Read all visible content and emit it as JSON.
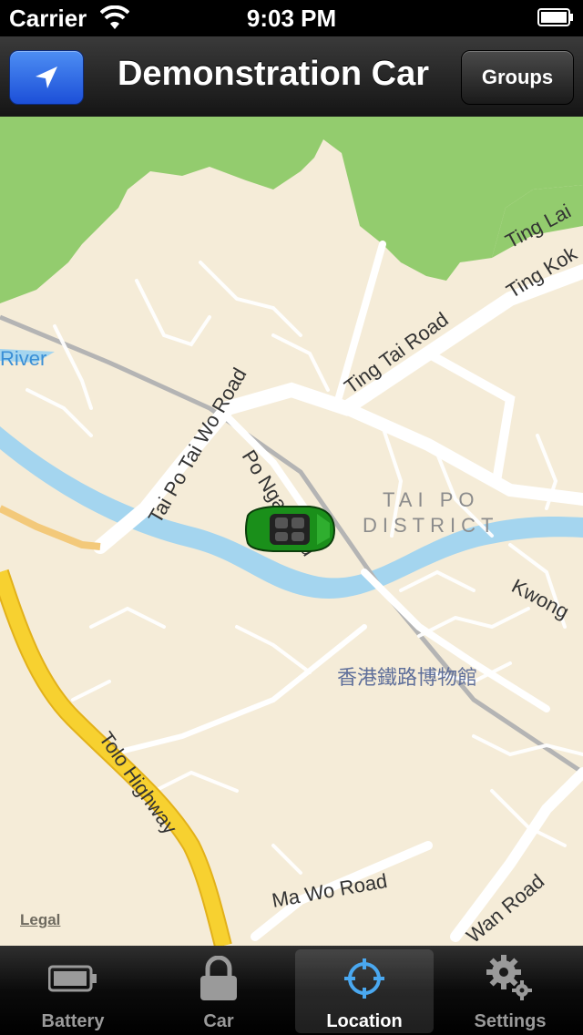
{
  "status_bar": {
    "carrier": "Carrier",
    "time": "9:03 PM"
  },
  "nav": {
    "title": "Demonstration Car",
    "groups_label": "Groups",
    "locate_icon": "location-arrow-icon"
  },
  "map": {
    "labels": {
      "river": "River",
      "ting_lai": "Ting Lai",
      "ting_kok": "Ting Kok",
      "ting_tai_road": "Ting Tai Road",
      "tai_po_tai_wo_road": "Tai Po Tai Wo Road",
      "po_nga_road": "Po Nga Road",
      "tai_po": "TAI PO",
      "district": "DISTRICT",
      "kwong": "Kwong",
      "museum": "香港鐵路博物館",
      "tolo_highway": "Tolo Highway",
      "wan_road": "Wan Road",
      "ma_wo_road": "Ma Wo Road"
    },
    "legal": "Legal",
    "colors": {
      "land": "#f5ecd8",
      "park": "#93cc6e",
      "water": "#a4d5ef",
      "highway": "#f7d130",
      "road": "#ffffff"
    }
  },
  "tabbar": {
    "tabs": [
      {
        "label": "Battery",
        "icon": "battery-icon",
        "selected": false
      },
      {
        "label": "Car",
        "icon": "lock-icon",
        "selected": false
      },
      {
        "label": "Location",
        "icon": "crosshair-icon",
        "selected": true
      },
      {
        "label": "Settings",
        "icon": "gear-icon",
        "selected": false
      }
    ]
  }
}
